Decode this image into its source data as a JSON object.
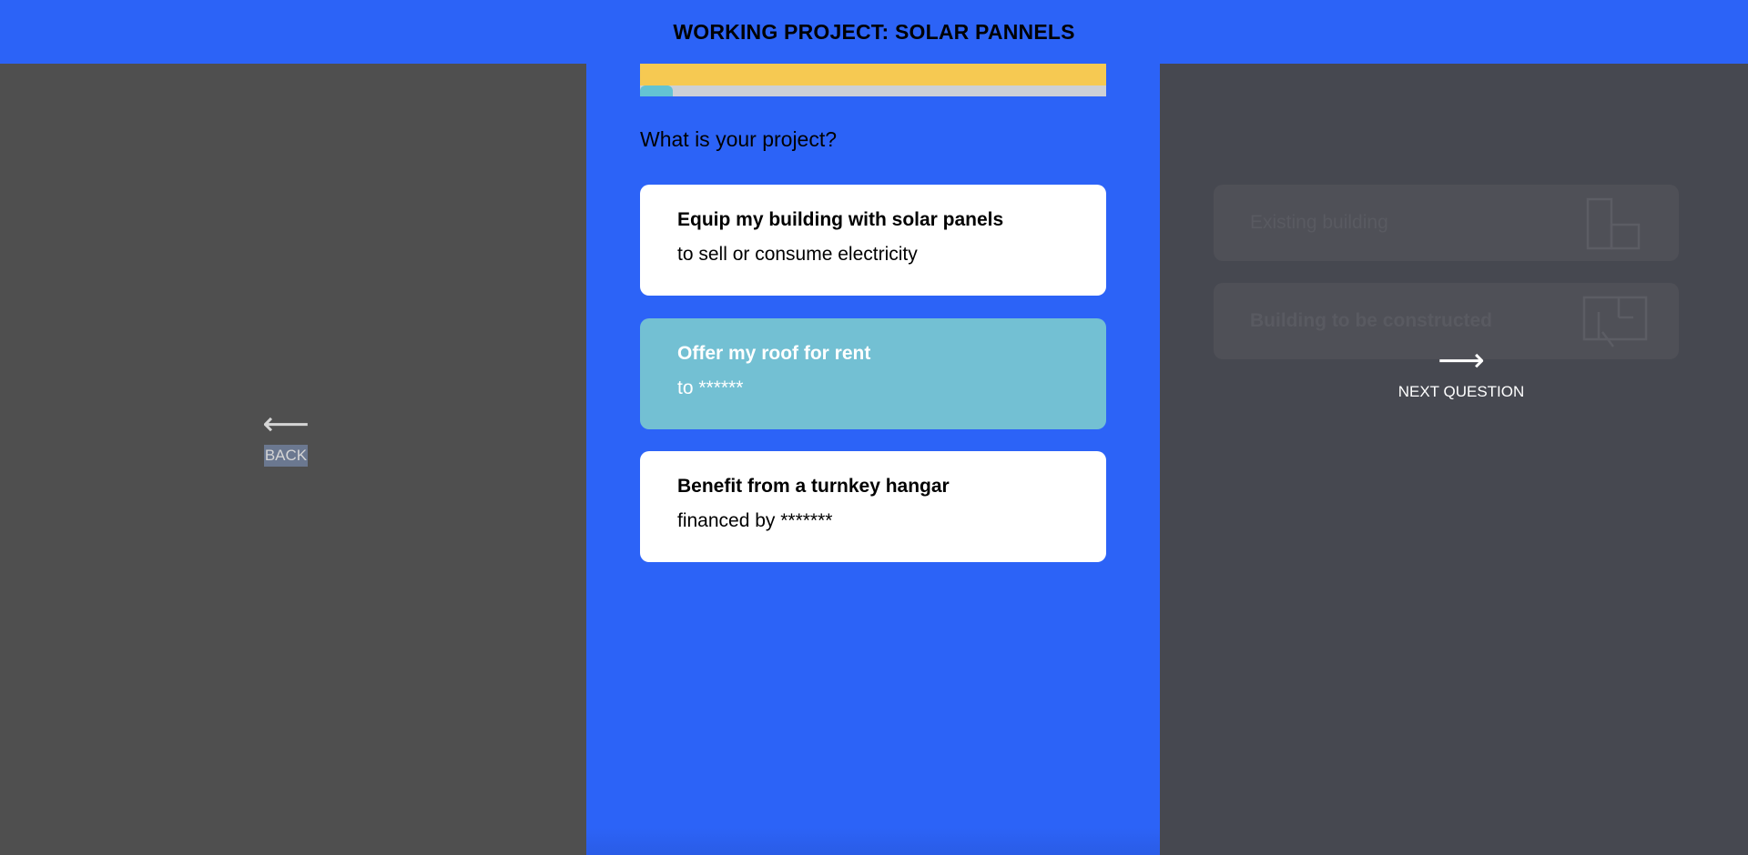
{
  "header": {
    "title": "WORKING PROJECT: SOLAR PANNELS"
  },
  "progress": {
    "fraction": 0.07
  },
  "question": "What is your project?",
  "options": [
    {
      "title": "Equip my building with solar panels",
      "subtitle": "to sell or consume electricity",
      "selected": false
    },
    {
      "title": "Offer my roof for rent",
      "subtitle": "to ******",
      "selected": true
    },
    {
      "title": "Benefit from a turnkey hangar",
      "subtitle": "financed by *******",
      "selected": false
    }
  ],
  "nav": {
    "back": {
      "icon": "arrow-left-icon",
      "label": "BACK"
    },
    "next": {
      "icon": "arrow-right-icon",
      "label": "NEXT QUESTION"
    }
  },
  "next_preview": {
    "options": [
      {
        "label": "Existing building",
        "icon": "building-icon"
      },
      {
        "label": "Building to be constructed",
        "icon": "blueprint-icon"
      }
    ]
  },
  "colors": {
    "primary": "#2c63f7",
    "selected_option": "#73c0d3",
    "progress_yellow": "#f6c952",
    "progress_fill": "#64c3d3",
    "side_panel_left": "#4f4f4f",
    "side_panel_right": "#464850"
  }
}
